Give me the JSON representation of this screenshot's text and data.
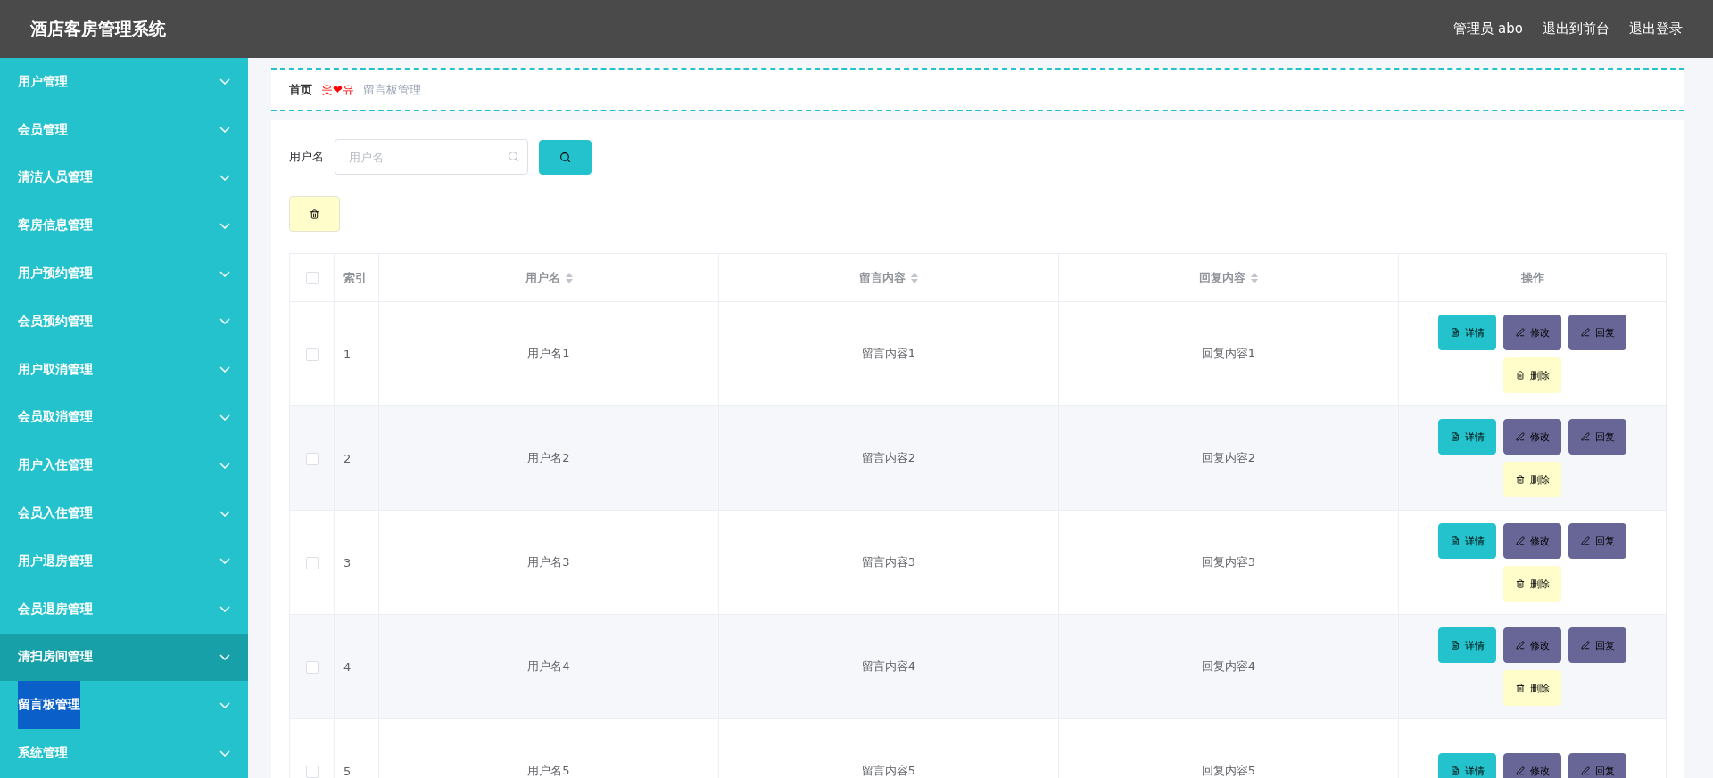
{
  "header": {
    "title": "酒店客房管理系统",
    "user": "管理员 abo",
    "links": [
      "退出到前台",
      "退出登录"
    ]
  },
  "sidebar": {
    "items": [
      {
        "label": "用户管理",
        "selected": false,
        "hovered": false
      },
      {
        "label": "会员管理",
        "selected": false,
        "hovered": false
      },
      {
        "label": "清洁人员管理",
        "selected": false,
        "hovered": false
      },
      {
        "label": "客房信息管理",
        "selected": false,
        "hovered": false
      },
      {
        "label": "用户预约管理",
        "selected": false,
        "hovered": false
      },
      {
        "label": "会员预约管理",
        "selected": false,
        "hovered": false
      },
      {
        "label": "用户取消管理",
        "selected": false,
        "hovered": false
      },
      {
        "label": "会员取消管理",
        "selected": false,
        "hovered": false
      },
      {
        "label": "用户入住管理",
        "selected": false,
        "hovered": false
      },
      {
        "label": "会员入住管理",
        "selected": false,
        "hovered": false
      },
      {
        "label": "用户退房管理",
        "selected": false,
        "hovered": false
      },
      {
        "label": "会员退房管理",
        "selected": false,
        "hovered": false
      },
      {
        "label": "清扫房间管理",
        "selected": false,
        "hovered": true
      },
      {
        "label": "留言板管理",
        "selected": true,
        "hovered": false
      },
      {
        "label": "系统管理",
        "selected": false,
        "hovered": false
      }
    ]
  },
  "breadcrumb": {
    "home": "首页",
    "separator": "웃❤유",
    "current": "留言板管理"
  },
  "search": {
    "label": "用户名",
    "placeholder": "用户名"
  },
  "table": {
    "all_checked": false,
    "columns": [
      {
        "label": "索引",
        "sortable": false
      },
      {
        "label": "用户名",
        "sortable": true
      },
      {
        "label": "留言内容",
        "sortable": true
      },
      {
        "label": "回复内容",
        "sortable": true
      },
      {
        "label": "操作",
        "sortable": false
      }
    ],
    "rows": [
      {
        "checked": false,
        "index": "1",
        "username": "用户名1",
        "content": "留言内容1",
        "reply": "回复内容1",
        "actions": [
          {
            "kind": "detail",
            "label": "详情"
          },
          {
            "kind": "edit",
            "label": "修改"
          },
          {
            "kind": "reply",
            "label": "回复"
          },
          {
            "kind": "delete",
            "label": "删除"
          }
        ]
      },
      {
        "checked": false,
        "index": "2",
        "username": "用户名2",
        "content": "留言内容2",
        "reply": "回复内容2",
        "actions": [
          {
            "kind": "detail",
            "label": "详情"
          },
          {
            "kind": "edit",
            "label": "修改"
          },
          {
            "kind": "reply",
            "label": "回复"
          },
          {
            "kind": "delete",
            "label": "删除"
          }
        ]
      },
      {
        "checked": false,
        "index": "3",
        "username": "用户名3",
        "content": "留言内容3",
        "reply": "回复内容3",
        "actions": [
          {
            "kind": "detail",
            "label": "详情"
          },
          {
            "kind": "edit",
            "label": "修改"
          },
          {
            "kind": "reply",
            "label": "回复"
          },
          {
            "kind": "delete",
            "label": "删除"
          }
        ]
      },
      {
        "checked": false,
        "index": "4",
        "username": "用户名4",
        "content": "留言内容4",
        "reply": "回复内容4",
        "actions": [
          {
            "kind": "detail",
            "label": "详情"
          },
          {
            "kind": "edit",
            "label": "修改"
          },
          {
            "kind": "reply",
            "label": "回复"
          },
          {
            "kind": "delete",
            "label": "删除"
          }
        ]
      },
      {
        "checked": false,
        "index": "5",
        "username": "用户名5",
        "content": "留言内容5",
        "reply": "回复内容5",
        "actions": [
          {
            "kind": "detail",
            "label": "详情"
          },
          {
            "kind": "edit",
            "label": "修改"
          },
          {
            "kind": "reply",
            "label": "回复"
          }
        ]
      }
    ]
  }
}
